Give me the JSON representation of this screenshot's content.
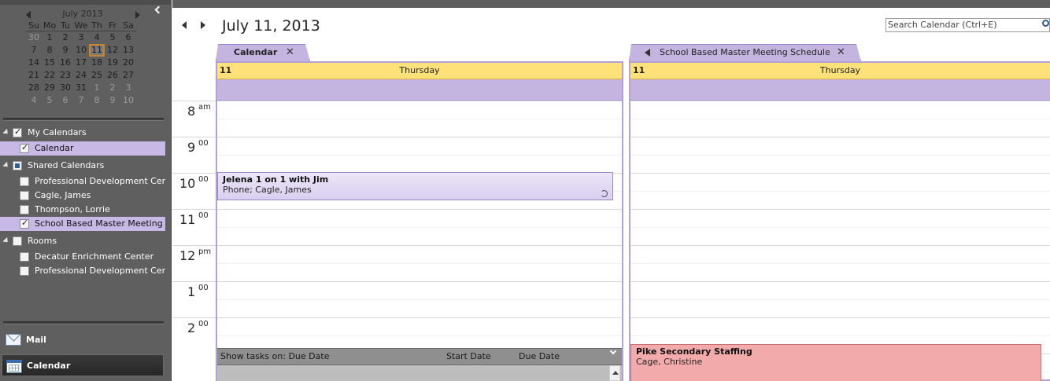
{
  "minical": {
    "month_label": "July 2013",
    "dow": [
      "Su",
      "Mo",
      "Tu",
      "We",
      "Th",
      "Fr",
      "Sa"
    ],
    "weeks": [
      [
        {
          "d": "30",
          "o": true
        },
        {
          "d": "1"
        },
        {
          "d": "2"
        },
        {
          "d": "3"
        },
        {
          "d": "4"
        },
        {
          "d": "5"
        },
        {
          "d": "6"
        }
      ],
      [
        {
          "d": "7"
        },
        {
          "d": "8"
        },
        {
          "d": "9"
        },
        {
          "d": "10"
        },
        {
          "d": "11",
          "t": true
        },
        {
          "d": "12"
        },
        {
          "d": "13"
        }
      ],
      [
        {
          "d": "14"
        },
        {
          "d": "15"
        },
        {
          "d": "16"
        },
        {
          "d": "17"
        },
        {
          "d": "18"
        },
        {
          "d": "19"
        },
        {
          "d": "20"
        }
      ],
      [
        {
          "d": "21"
        },
        {
          "d": "22"
        },
        {
          "d": "23"
        },
        {
          "d": "24"
        },
        {
          "d": "25"
        },
        {
          "d": "26"
        },
        {
          "d": "27"
        }
      ],
      [
        {
          "d": "28"
        },
        {
          "d": "29"
        },
        {
          "d": "30"
        },
        {
          "d": "31"
        },
        {
          "d": "1",
          "o": true
        },
        {
          "d": "2",
          "o": true
        },
        {
          "d": "3",
          "o": true
        }
      ],
      [
        {
          "d": "4",
          "o": true
        },
        {
          "d": "5",
          "o": true
        },
        {
          "d": "6",
          "o": true
        },
        {
          "d": "7",
          "o": true
        },
        {
          "d": "8",
          "o": true
        },
        {
          "d": "9",
          "o": true
        },
        {
          "d": "10",
          "o": true
        }
      ]
    ]
  },
  "folders": {
    "my_calendars": {
      "label": "My Calendars",
      "items": [
        {
          "label": "Calendar",
          "checked": true,
          "selected": true
        }
      ]
    },
    "shared_calendars": {
      "label": "Shared Calendars",
      "items": [
        {
          "label": "Professional Development Center",
          "checked": false
        },
        {
          "label": "Cagle,  James",
          "checked": false
        },
        {
          "label": "Thompson,  Lorrie",
          "checked": false
        },
        {
          "label": "School Based Master Meeting Schedule",
          "checked": true,
          "selected": true
        }
      ]
    },
    "rooms": {
      "label": "Rooms",
      "items": [
        {
          "label": "Decatur Enrichment Center",
          "checked": false
        },
        {
          "label": "Professional Development Center",
          "checked": false
        }
      ]
    }
  },
  "nav_buttons": {
    "mail": "Mail",
    "calendar": "Calendar"
  },
  "header": {
    "date_title": "July 11, 2013",
    "search_placeholder": "Search Calendar (Ctrl+E)"
  },
  "times": [
    {
      "hour": "8",
      "suffix": "am"
    },
    {
      "hour": "9",
      "suffix": "00"
    },
    {
      "hour": "10",
      "suffix": "00"
    },
    {
      "hour": "11",
      "suffix": "00"
    },
    {
      "hour": "12",
      "suffix": "pm"
    },
    {
      "hour": "1",
      "suffix": "00"
    },
    {
      "hour": "2",
      "suffix": "00"
    }
  ],
  "calendars": [
    {
      "tab_label": "Calendar",
      "day_num": "11",
      "day_name": "Thursday",
      "appointments": [
        {
          "subject": "Jelena 1 on 1 with Jim",
          "location": "Phone; Cagle,  James",
          "recurring": true
        }
      ],
      "tasks": {
        "label": "Show tasks on: Due Date",
        "start": "Start Date",
        "due": "Due Date"
      }
    },
    {
      "tab_label": "School Based Master Meeting Schedule",
      "day_num": "11",
      "day_name": "Thursday",
      "appointments": [
        {
          "subject": "Pike Secondary Staffing",
          "location": "Cage,  Christine",
          "recurring": false
        }
      ]
    }
  ],
  "colors": {
    "accent_purple": "#c4b4e0",
    "day_header": "#ffe17a",
    "appt_red": "#f2aaaa",
    "today_border": "#c9842e"
  }
}
